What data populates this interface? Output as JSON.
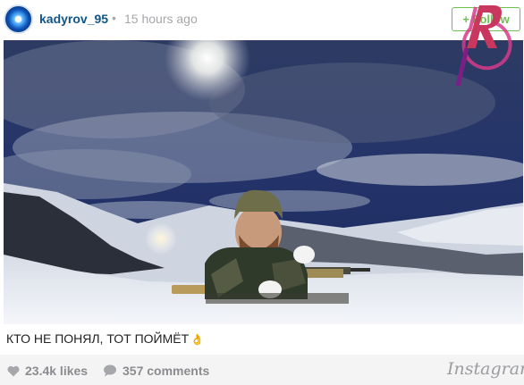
{
  "header": {
    "username": "kadyrov_95",
    "separator": "•",
    "time": "15 hours ago",
    "follow_label": "+ Follow"
  },
  "caption": {
    "text": "КТО НЕ ПОНЯЛ, ТОТ ПОЙМЁТ",
    "emoji": "👌"
  },
  "footer": {
    "likes": "23.4k likes",
    "comments": "357 comments",
    "brand": "Instagram"
  },
  "colors": {
    "username": "#125688",
    "follow": "#70c050",
    "muted": "#a5a7aa",
    "footer_bg": "#f4f4f4"
  },
  "icons": {
    "like": "heart-icon",
    "comment": "speech-bubble-icon"
  }
}
